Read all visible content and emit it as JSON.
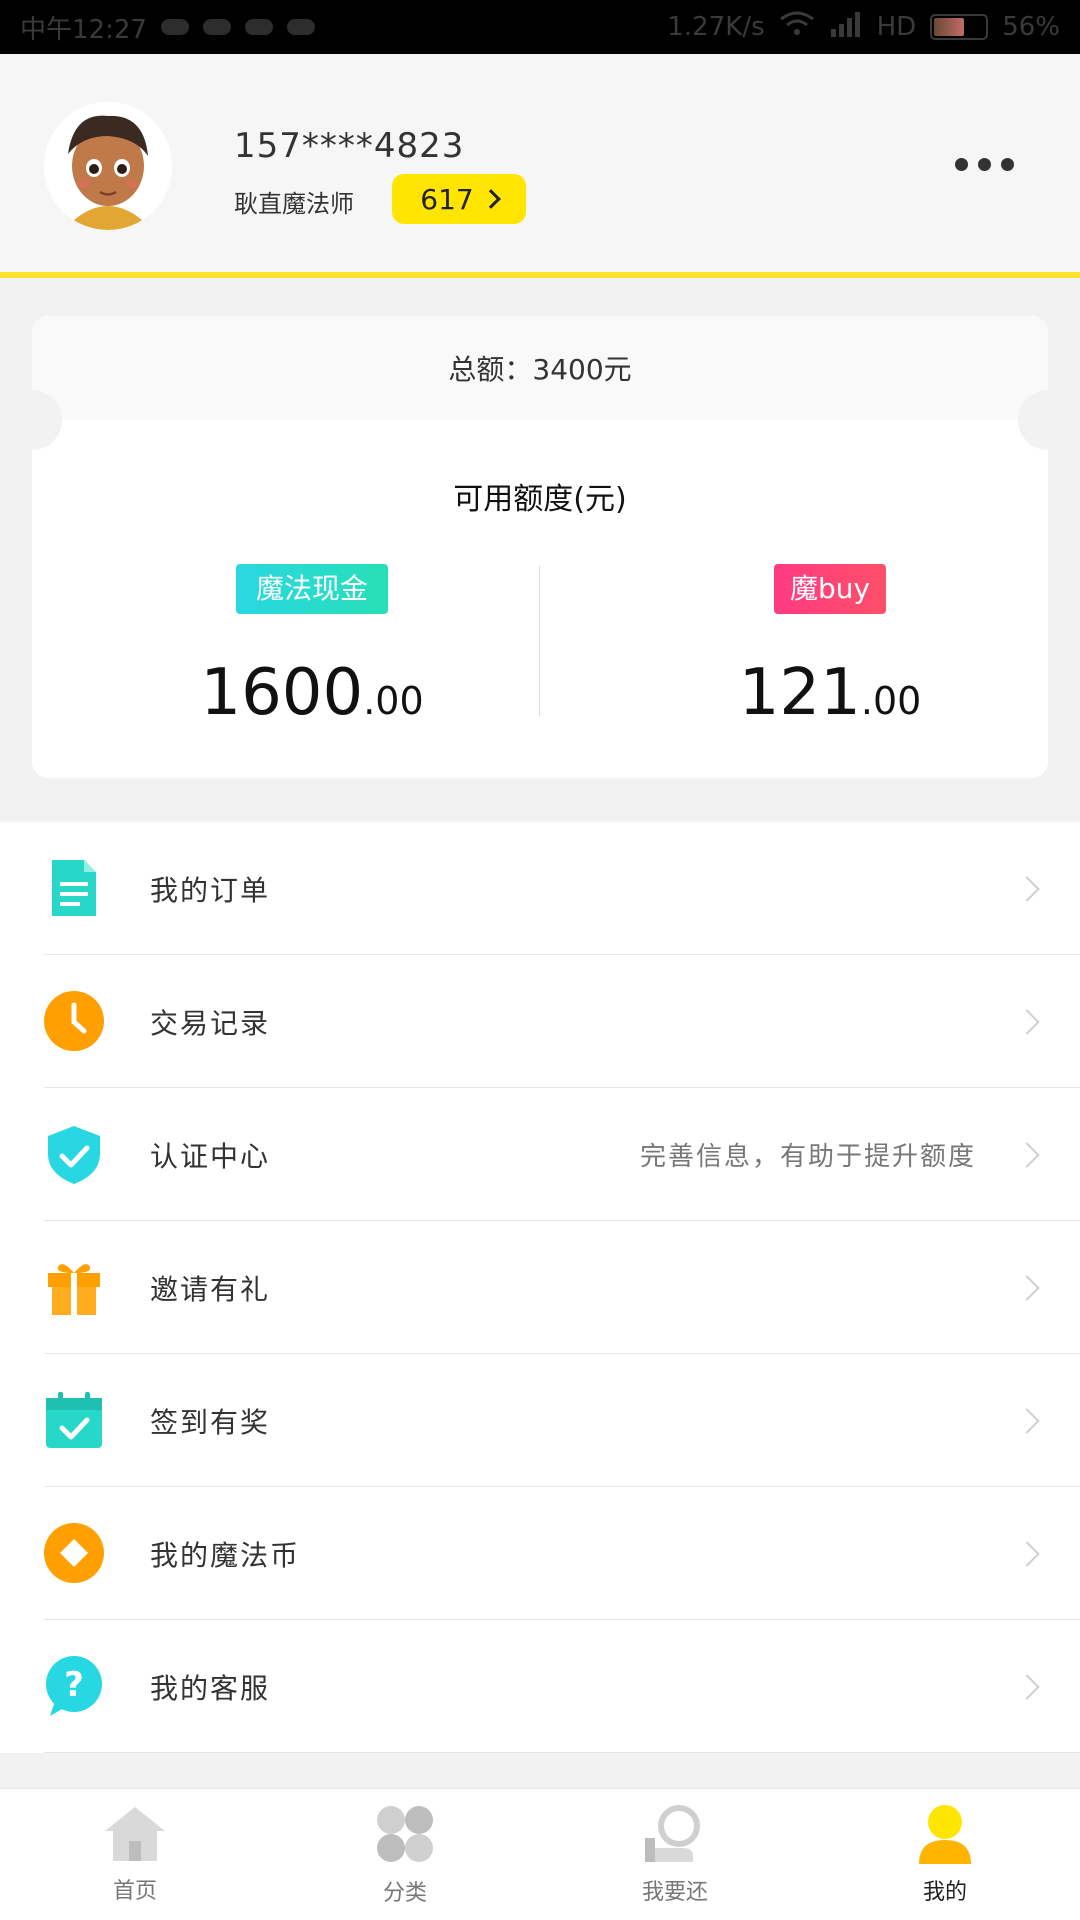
{
  "status_bar": {
    "time": "中午12:27",
    "speed": "1.27K/s",
    "hd": "HD",
    "battery": "56%"
  },
  "profile": {
    "phone": "157****4823",
    "title": "耿直魔法师",
    "score": "617"
  },
  "credit": {
    "total_label": "总额：",
    "total_value": "3400元",
    "available_label": "可用额度(元)",
    "cash_tag": "魔法现金",
    "cash_int": "1600",
    "cash_dec": ".00",
    "buy_tag": "魔buy",
    "buy_int": "121",
    "buy_dec": ".00"
  },
  "menu": [
    {
      "label": "我的订单"
    },
    {
      "label": "交易记录"
    },
    {
      "label": "认证中心",
      "hint": "完善信息，有助于提升额度"
    },
    {
      "label": "邀请有礼"
    },
    {
      "label": "签到有奖"
    },
    {
      "label": "我的魔法币"
    },
    {
      "label": "我的客服"
    }
  ],
  "bottom_nav": [
    {
      "label": "首页"
    },
    {
      "label": "分类"
    },
    {
      "label": "我要还"
    },
    {
      "label": "我的"
    }
  ],
  "colors": {
    "accent": "#ffe22a",
    "cyan": "#27d8e3",
    "orange": "#ff9f00",
    "pink": "#ff3a82"
  }
}
